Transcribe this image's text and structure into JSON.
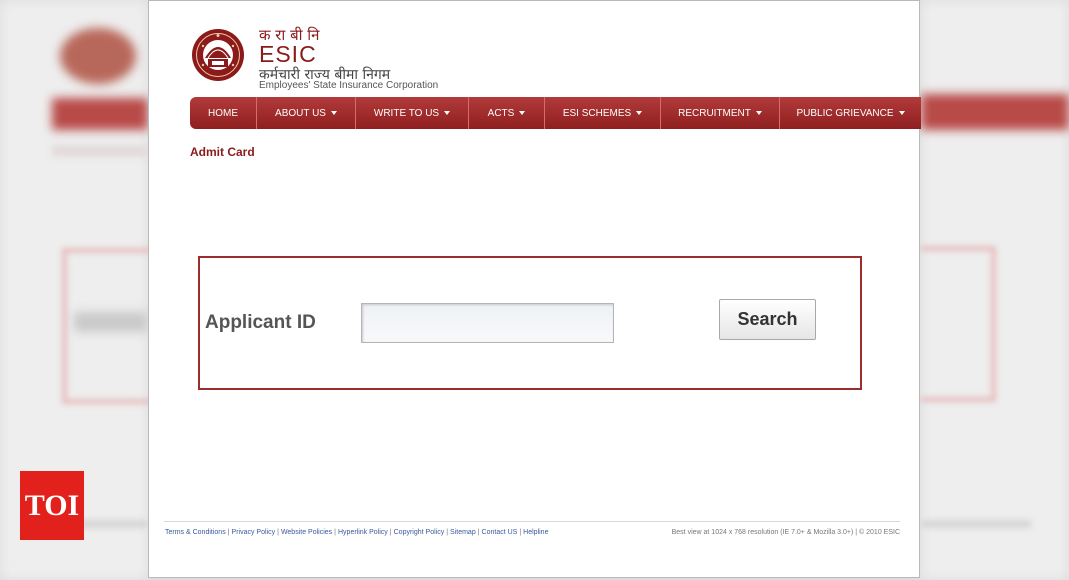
{
  "header": {
    "hindi_short": "क रा बी नि",
    "abbreviation": "ESIC",
    "hindi_full": "कर्मचारी राज्य बीमा निगम",
    "english_full": "Employees' State Insurance Corporation",
    "brand_color": "#8b1a1a",
    "logo_icon": "esic-emblem-icon"
  },
  "nav": {
    "items": [
      {
        "label": "HOME",
        "dropdown": false
      },
      {
        "label": "ABOUT US",
        "dropdown": true
      },
      {
        "label": "WRITE TO US",
        "dropdown": true
      },
      {
        "label": "ACTS",
        "dropdown": true
      },
      {
        "label": "ESI SCHEMES",
        "dropdown": true
      },
      {
        "label": "RECRUITMENT",
        "dropdown": true
      },
      {
        "label": "PUBLIC GRIEVANCE",
        "dropdown": true
      }
    ],
    "bar_color": "#a02c2c"
  },
  "breadcrumb": "Admit Card",
  "form": {
    "applicant_label": "Applicant ID",
    "applicant_value": "",
    "search_label": "Search",
    "border_color": "#9a2e2e"
  },
  "footer": {
    "links": [
      "Terms & Conditions",
      "Privacy Policy",
      "Website Policies",
      "Hyperlink Policy",
      "Copyright Policy",
      "Sitemap",
      "Contact US",
      "Helpline"
    ],
    "note": "Best view at 1024 x 768 resolution (IE 7.0+ & Mozilla 3.0+) | © 2010 ESIC"
  },
  "watermark": {
    "text": "TOI",
    "color": "#e2211c"
  }
}
